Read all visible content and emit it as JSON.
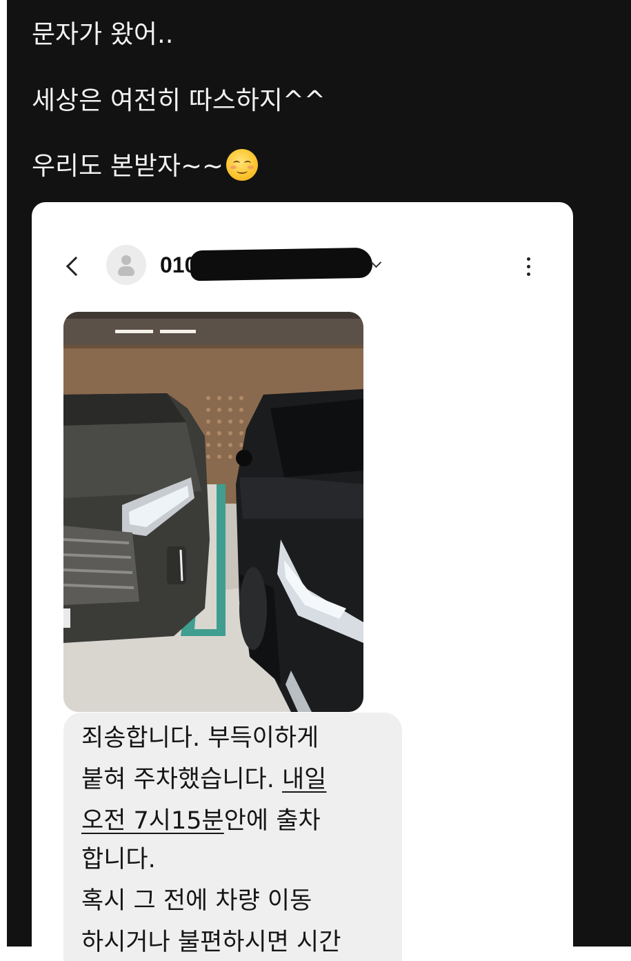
{
  "post": {
    "lines": [
      "문자가 왔어..",
      "세상은 여전히 따스하지^^",
      "우리도 본받자~~"
    ],
    "emoji": "smiling-face-with-blush-icon"
  },
  "message_screen": {
    "back_icon": "chevron-left-icon",
    "contact_avatar_icon": "person-avatar-icon",
    "phone_number_visible": "010",
    "phone_number_redacted": true,
    "expand_icon": "chevron-down-icon",
    "more_icon": "more-vertical-icon",
    "attachment": {
      "description_icon": "parked-cars-photo"
    },
    "message": {
      "line1": "죄송합니다.  부득이하게",
      "line2_a": "붙혀 주차했습니다. ",
      "line2_u": "내일",
      "line3_u": "오전 7시15분",
      "line3_b": "안에 출차",
      "line4": "합니다.",
      "line5": "혹시 그 전에  차량 이동",
      "line6": "하시거나 불편하시면 시간"
    }
  },
  "colors": {
    "background": "#121212",
    "post_text": "#f2f2f2",
    "card": "#ffffff",
    "bubble": "#efefef",
    "redaction": "#0d0d0d"
  }
}
